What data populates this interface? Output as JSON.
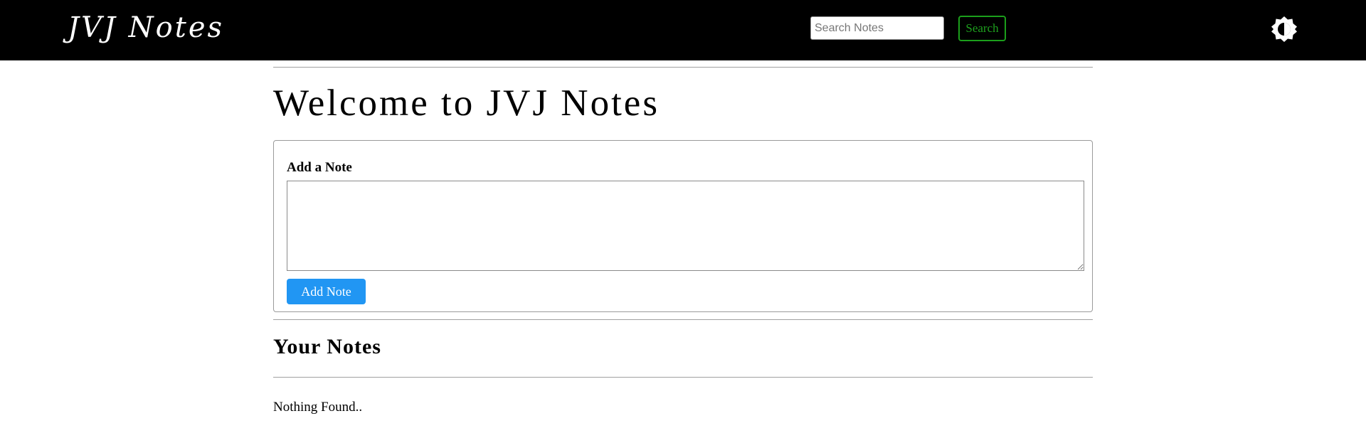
{
  "navbar": {
    "brand": "JVJ Notes",
    "search": {
      "placeholder": "Search Notes",
      "value": "",
      "button_label": "Search"
    },
    "theme_toggle_icon": "contrast-icon"
  },
  "main": {
    "title": "Welcome to JVJ Notes",
    "add_note": {
      "label": "Add a Note",
      "textarea_value": "",
      "button_label": "Add Note"
    },
    "notes_section": {
      "title": "Your Notes",
      "empty_message": "Nothing Found.."
    }
  },
  "colors": {
    "navbar_bg": "#000000",
    "search_button_accent": "#1ea01e",
    "add_button_bg": "#2196f3"
  }
}
